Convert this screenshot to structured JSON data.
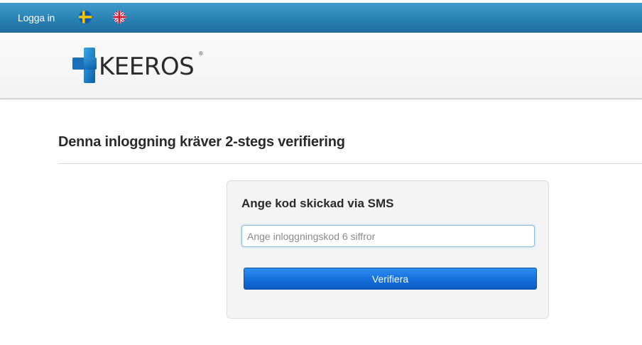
{
  "topbar": {
    "login_label": "Logga in",
    "languages": [
      {
        "code": "sv",
        "icon": "sweden-flag-icon"
      },
      {
        "code": "en",
        "icon": "uk-flag-icon"
      }
    ],
    "colors": {
      "bar_top": "#3f9ccc",
      "bar_bottom": "#1f6e9e"
    }
  },
  "header": {
    "logo_text": "KEEROS",
    "logo_mark": "®",
    "logo_colors": {
      "cross": "#1f7fc4"
    }
  },
  "main": {
    "title": "Denna inloggning kräver 2-stegs verifiering",
    "panel": {
      "heading": "Ange kod skickad via SMS",
      "code_input": {
        "value": "",
        "placeholder": "Ange inloggningskod 6 siffror"
      },
      "verify_label": "Verifiera"
    }
  },
  "colors": {
    "accent": "#1670dd"
  }
}
